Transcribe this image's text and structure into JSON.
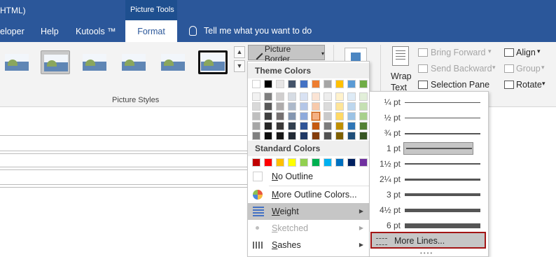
{
  "title_fragment": "HTML)",
  "context_tab_header": "Picture Tools",
  "tabs": [
    {
      "label": "eloper"
    },
    {
      "label": "Help"
    },
    {
      "label": "Kutools ™"
    },
    {
      "label": "Format",
      "active": true
    }
  ],
  "tell_me": "Tell me what you want to do",
  "ribbon": {
    "picture_styles_label": "Picture Styles",
    "picture_border": "Picture Border",
    "arrange": {
      "wrap_text_line1": "Wrap",
      "wrap_text_line2": "Text",
      "bring_forward": "Bring Forward",
      "send_backward": "Send Backward",
      "selection_pane": "Selection Pane",
      "align": "Align",
      "group": "Group",
      "rotate": "Rotate"
    }
  },
  "menu": {
    "theme_colors_label": "Theme Colors",
    "standard_colors_label": "Standard Colors",
    "theme_top_row": [
      "#ffffff",
      "#000000",
      "#e7e6e6",
      "#44546a",
      "#4472c4",
      "#ed7d31",
      "#a5a5a5",
      "#ffc000",
      "#5b9bd5",
      "#70ad47"
    ],
    "theme_shades": [
      [
        "#f2f2f2",
        "#7f7f7f",
        "#d0cece",
        "#d6dce4",
        "#d9e2f3",
        "#fbe4d5",
        "#ededed",
        "#fff2cc",
        "#deebf6",
        "#e2efd9"
      ],
      [
        "#d9d9d9",
        "#595959",
        "#aeabab",
        "#adb9ca",
        "#b4c6e7",
        "#f7caac",
        "#dbdbdb",
        "#fee599",
        "#bdd7ee",
        "#c5e0b3"
      ],
      [
        "#bfbfbf",
        "#3f3f3f",
        "#757070",
        "#8496b0",
        "#8eaadb",
        "#f4b183",
        "#c9c9c9",
        "#ffd965",
        "#9cc3e5",
        "#a8d08d"
      ],
      [
        "#a6a6a6",
        "#262626",
        "#3a3838",
        "#323f4f",
        "#2f5496",
        "#c55a11",
        "#7b7b7b",
        "#bf8f00",
        "#2e75b5",
        "#538135"
      ],
      [
        "#7f7f7f",
        "#0d0d0d",
        "#171616",
        "#222a35",
        "#1f3864",
        "#833c0b",
        "#525252",
        "#7f6000",
        "#1f4e79",
        "#375623"
      ]
    ],
    "standard_colors": [
      "#c00000",
      "#ff0000",
      "#ffc000",
      "#ffff00",
      "#92d050",
      "#00b050",
      "#00b0f0",
      "#0070c0",
      "#002060",
      "#7030a0"
    ],
    "no_outline": "No Outline",
    "more_outline_colors": "More Outline Colors...",
    "weight": "Weight",
    "sketched": "Sketched",
    "dashes": "Dashes",
    "no_outline_accel": "N",
    "more_outline_accel": "M",
    "weight_accel": "W",
    "sketched_accel": "S",
    "dashes_accel": "S"
  },
  "weight_submenu": {
    "weights": [
      {
        "label": "¼ pt"
      },
      {
        "label": "½ pt"
      },
      {
        "label": "¾ pt"
      },
      {
        "label": "1 pt",
        "selected": true
      },
      {
        "label": "1½ pt"
      },
      {
        "label": "2¼ pt"
      },
      {
        "label": "3 pt"
      },
      {
        "label": "4½ pt"
      },
      {
        "label": "6 pt"
      }
    ],
    "more_lines": "More Lines..."
  }
}
